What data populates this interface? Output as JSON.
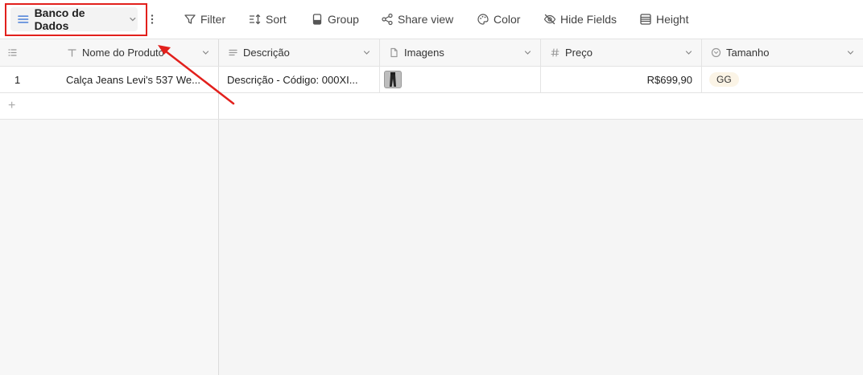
{
  "toolbar": {
    "view_name": "Banco de Dados",
    "tools": [
      {
        "label": "Filter",
        "icon": "filter-icon"
      },
      {
        "label": "Sort",
        "icon": "sort-icon"
      },
      {
        "label": "Group",
        "icon": "group-icon"
      },
      {
        "label": "Share view",
        "icon": "share-icon"
      },
      {
        "label": "Color",
        "icon": "palette-icon"
      },
      {
        "label": "Hide Fields",
        "icon": "eye-off-icon"
      },
      {
        "label": "Height",
        "icon": "row-height-icon"
      }
    ]
  },
  "columns": [
    {
      "label": "Nome do Produto",
      "icon": "text-field-icon"
    },
    {
      "label": "Descrição",
      "icon": "long-text-field-icon"
    },
    {
      "label": "Imagens",
      "icon": "attachment-field-icon"
    },
    {
      "label": "Preço",
      "icon": "number-field-icon"
    },
    {
      "label": "Tamanho",
      "icon": "single-select-field-icon"
    }
  ],
  "rows": [
    {
      "index": "1",
      "nome": "Calça Jeans Levi's 537 We...",
      "descricao": "Descrição - Código: 000XI...",
      "imagens": "jeans-thumbnail",
      "preco": "R$699,90",
      "tamanho": "GG"
    }
  ],
  "add_row_symbol": "+",
  "colors": {
    "accent": "#4a7fd8",
    "annotation": "#e2201c",
    "tag_bg": "#fbf4e6"
  }
}
